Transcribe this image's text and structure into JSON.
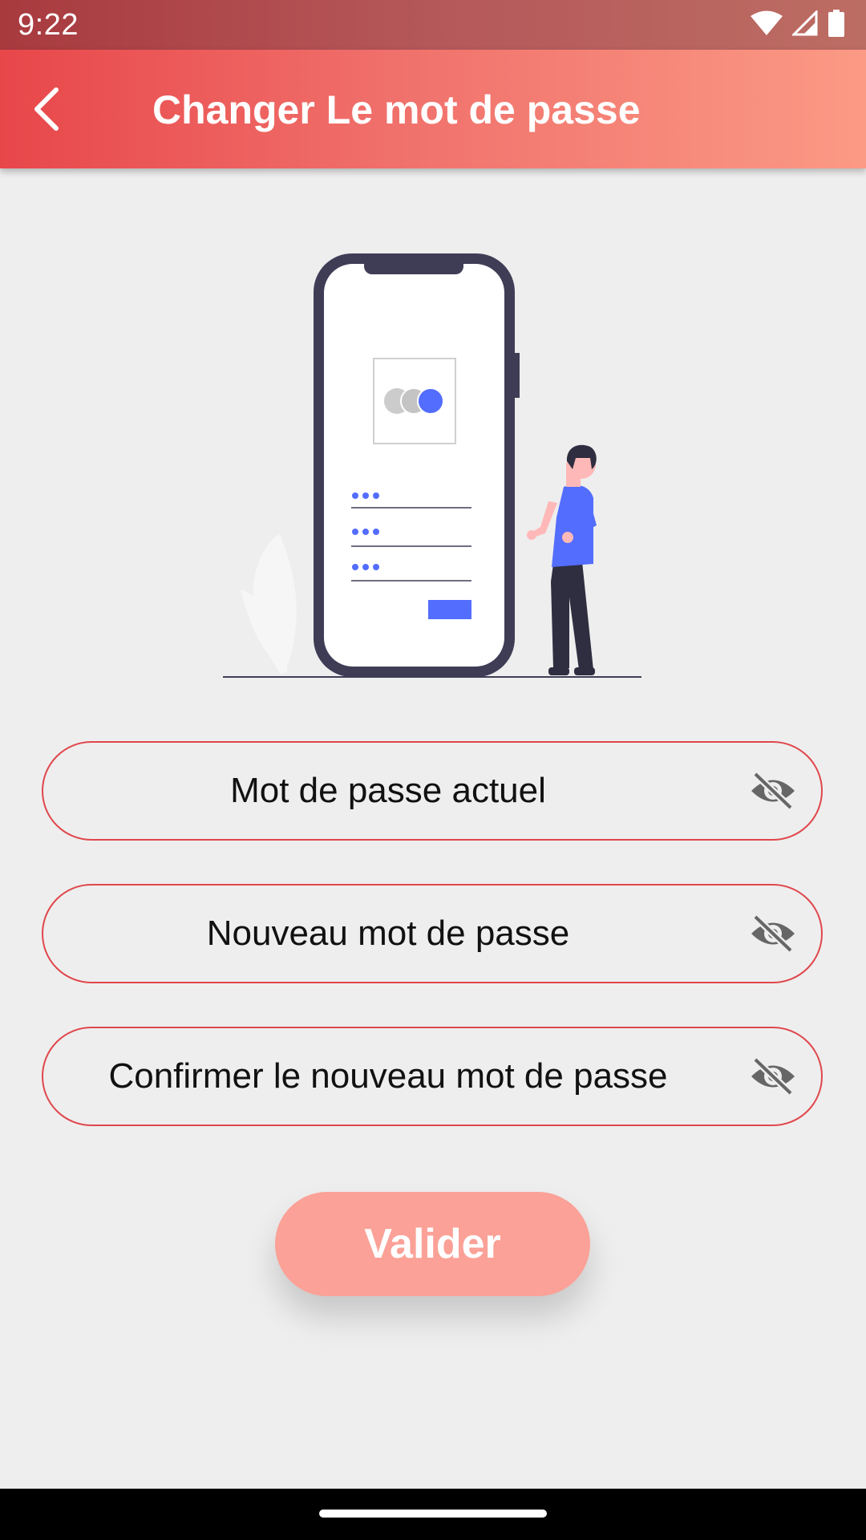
{
  "status_bar": {
    "time": "9:22",
    "icons": [
      "wifi-icon",
      "signal-icon",
      "battery-icon"
    ]
  },
  "app_bar": {
    "title": "Changer Le mot de passe",
    "back_icon": "chevron-left-icon"
  },
  "illustration": {
    "name": "phone-login-illustration",
    "colors": {
      "accent": "#536dfe",
      "dark": "#3f3d56",
      "skin": "#ffb8b8"
    }
  },
  "fields": [
    {
      "placeholder": "Mot de passe actuel",
      "toggle_icon": "eye-off-icon"
    },
    {
      "placeholder": "Nouveau mot de passe",
      "toggle_icon": "eye-off-icon"
    },
    {
      "placeholder": "Confirmer le nouveau mot de passe",
      "toggle_icon": "eye-off-icon"
    }
  ],
  "validate_button": {
    "label": "Valider"
  },
  "colors": {
    "accent": "#e0474c",
    "app_bar_start": "#e8474a",
    "app_bar_end": "#fb9a85",
    "button": "#fba197",
    "background": "#eeeeee"
  }
}
